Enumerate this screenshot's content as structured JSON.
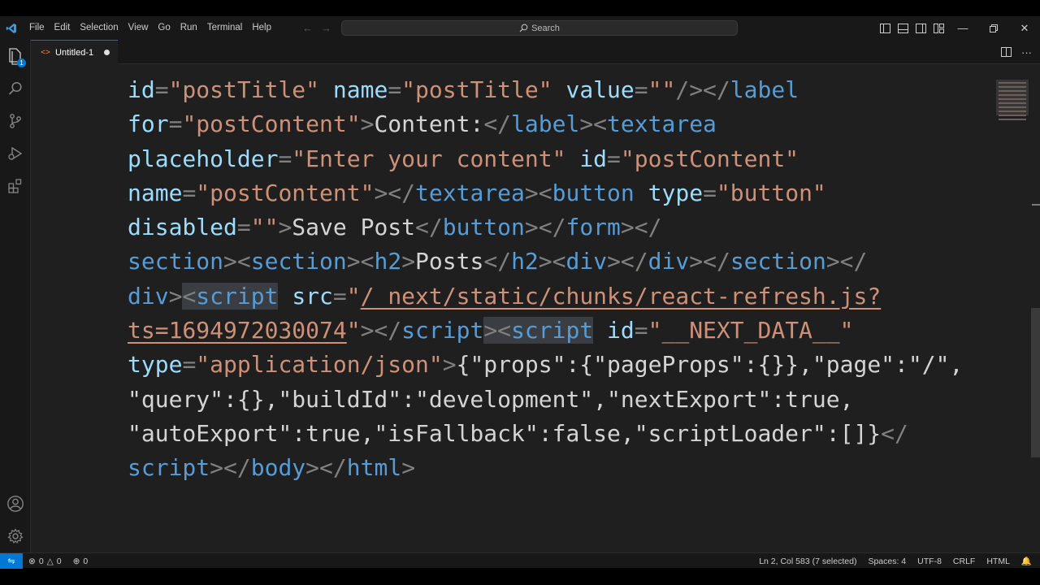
{
  "menu": [
    "File",
    "Edit",
    "Selection",
    "View",
    "Go",
    "Run",
    "Terminal",
    "Help"
  ],
  "search": {
    "label": "Search"
  },
  "explorer_badge": "1",
  "tab": {
    "label": "Untitled-1"
  },
  "code_lines": [
    [
      [
        "attr",
        "id"
      ],
      [
        "punc",
        "="
      ],
      [
        "str",
        "\"postTitle\""
      ],
      [
        "text",
        " "
      ],
      [
        "attr",
        "name"
      ],
      [
        "punc",
        "="
      ],
      [
        "str",
        "\"postTitle\""
      ],
      [
        "text",
        " "
      ],
      [
        "attr",
        "value"
      ],
      [
        "punc",
        "="
      ],
      [
        "str",
        "\"\""
      ],
      [
        "punc",
        "/></"
      ],
      [
        "tag",
        "label"
      ]
    ],
    [
      [
        "attr",
        "for"
      ],
      [
        "punc",
        "="
      ],
      [
        "str",
        "\"postContent\""
      ],
      [
        "punc",
        ">"
      ],
      [
        "text",
        "Content:"
      ],
      [
        "punc",
        "</"
      ],
      [
        "tag",
        "label"
      ],
      [
        "punc",
        "><"
      ],
      [
        "tag",
        "textarea"
      ]
    ],
    [
      [
        "attr",
        "placeholder"
      ],
      [
        "punc",
        "="
      ],
      [
        "str",
        "\"Enter your content\""
      ],
      [
        "text",
        " "
      ],
      [
        "attr",
        "id"
      ],
      [
        "punc",
        "="
      ],
      [
        "str",
        "\"postContent\""
      ]
    ],
    [
      [
        "attr",
        "name"
      ],
      [
        "punc",
        "="
      ],
      [
        "str",
        "\"postContent\""
      ],
      [
        "punc",
        "></"
      ],
      [
        "tag",
        "textarea"
      ],
      [
        "punc",
        "><"
      ],
      [
        "tag",
        "button"
      ],
      [
        "text",
        " "
      ],
      [
        "attr",
        "type"
      ],
      [
        "punc",
        "="
      ],
      [
        "str",
        "\"button\""
      ]
    ],
    [
      [
        "attr",
        "disabled"
      ],
      [
        "punc",
        "="
      ],
      [
        "str",
        "\"\""
      ],
      [
        "punc",
        ">"
      ],
      [
        "text",
        "Save Post"
      ],
      [
        "punc",
        "</"
      ],
      [
        "tag",
        "button"
      ],
      [
        "punc",
        "></"
      ],
      [
        "tag",
        "form"
      ],
      [
        "punc",
        "></"
      ]
    ],
    [
      [
        "tag",
        "section"
      ],
      [
        "punc",
        "><"
      ],
      [
        "tag",
        "section"
      ],
      [
        "punc",
        "><"
      ],
      [
        "tag",
        "h2"
      ],
      [
        "punc",
        ">"
      ],
      [
        "text",
        "Posts"
      ],
      [
        "punc",
        "</"
      ],
      [
        "tag",
        "h2"
      ],
      [
        "punc",
        "><"
      ],
      [
        "tag",
        "div"
      ],
      [
        "punc",
        "></"
      ],
      [
        "tag",
        "div"
      ],
      [
        "punc",
        "></"
      ],
      [
        "tag",
        "section"
      ],
      [
        "punc",
        "></"
      ]
    ],
    [
      [
        "tag",
        "div"
      ],
      [
        "punc",
        ">"
      ],
      [
        "hlpunc",
        "<"
      ],
      [
        "hltag",
        "script"
      ],
      [
        "text",
        " "
      ],
      [
        "attr",
        "src"
      ],
      [
        "punc",
        "="
      ],
      [
        "str",
        "\""
      ],
      [
        "link",
        "/_next/static/chunks/react-refresh.js?"
      ]
    ],
    [
      [
        "link",
        "ts=1694972030074"
      ],
      [
        "str",
        "\""
      ],
      [
        "punc",
        "></"
      ],
      [
        "tag",
        "script"
      ],
      [
        "hlpunc",
        "><"
      ],
      [
        "hltag",
        "script"
      ],
      [
        "text",
        " "
      ],
      [
        "attr",
        "id"
      ],
      [
        "punc",
        "="
      ],
      [
        "str",
        "\"__NEXT_DATA__\""
      ]
    ],
    [
      [
        "attr",
        "type"
      ],
      [
        "punc",
        "="
      ],
      [
        "str",
        "\"application/json\""
      ],
      [
        "punc",
        ">"
      ],
      [
        "text",
        "{\"props\":{\"pageProps\":{}},\"page\":\"/\","
      ]
    ],
    [
      [
        "text",
        "\"query\":{},\"buildId\":\"development\",\"nextExport\":true,"
      ]
    ],
    [
      [
        "text",
        "\"autoExport\":true,\"isFallback\":false,\"scriptLoader\":[]}"
      ],
      [
        "punc",
        "</"
      ]
    ],
    [
      [
        "tag",
        "script"
      ],
      [
        "punc",
        "></"
      ],
      [
        "tag",
        "body"
      ],
      [
        "punc",
        "></"
      ],
      [
        "tag",
        "html"
      ],
      [
        "punc",
        ">"
      ]
    ]
  ],
  "status": {
    "errors": "0",
    "warnings": "0",
    "ports": "0",
    "position": "Ln 2, Col 583 (7 selected)",
    "spaces": "Spaces: 4",
    "encoding": "UTF-8",
    "eol": "CRLF",
    "language": "HTML"
  },
  "colors": {
    "accent": "#0078d4",
    "string": "#ce9178",
    "attribute": "#9cdcfe",
    "tag": "#569cd6"
  },
  "icons": [
    "vscode-logo-icon",
    "explorer-icon",
    "search-icon",
    "source-control-icon",
    "run-debug-icon",
    "extensions-icon",
    "accounts-icon",
    "manage-gear-icon"
  ]
}
